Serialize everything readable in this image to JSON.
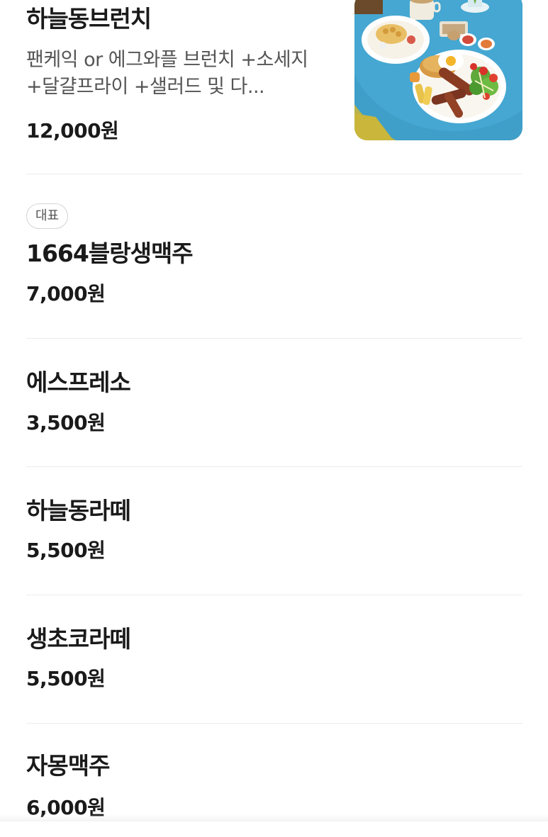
{
  "menu": {
    "items": [
      {
        "name": "하늘동브런치",
        "description": "팬케익 or 에그와플 브런치 +소세지 +달걀프라이 +샐러드 및 다...",
        "price": "12,000원",
        "has_image": true,
        "image_icon": "brunch-plate-photo"
      },
      {
        "badge": "대표",
        "name": "1664블랑생맥주",
        "price": "7,000원"
      },
      {
        "name": "에스프레소",
        "price": "3,500원"
      },
      {
        "name": "하늘동라떼",
        "price": "5,500원"
      },
      {
        "name": "생초코라떼",
        "price": "5,500원"
      },
      {
        "name": "자몽맥주",
        "price": "6,000원"
      }
    ]
  },
  "colors": {
    "table_blue": "#3f9fc9",
    "divider": "#ececec",
    "price_text": "#1a1a1a",
    "desc_text": "#555555"
  }
}
